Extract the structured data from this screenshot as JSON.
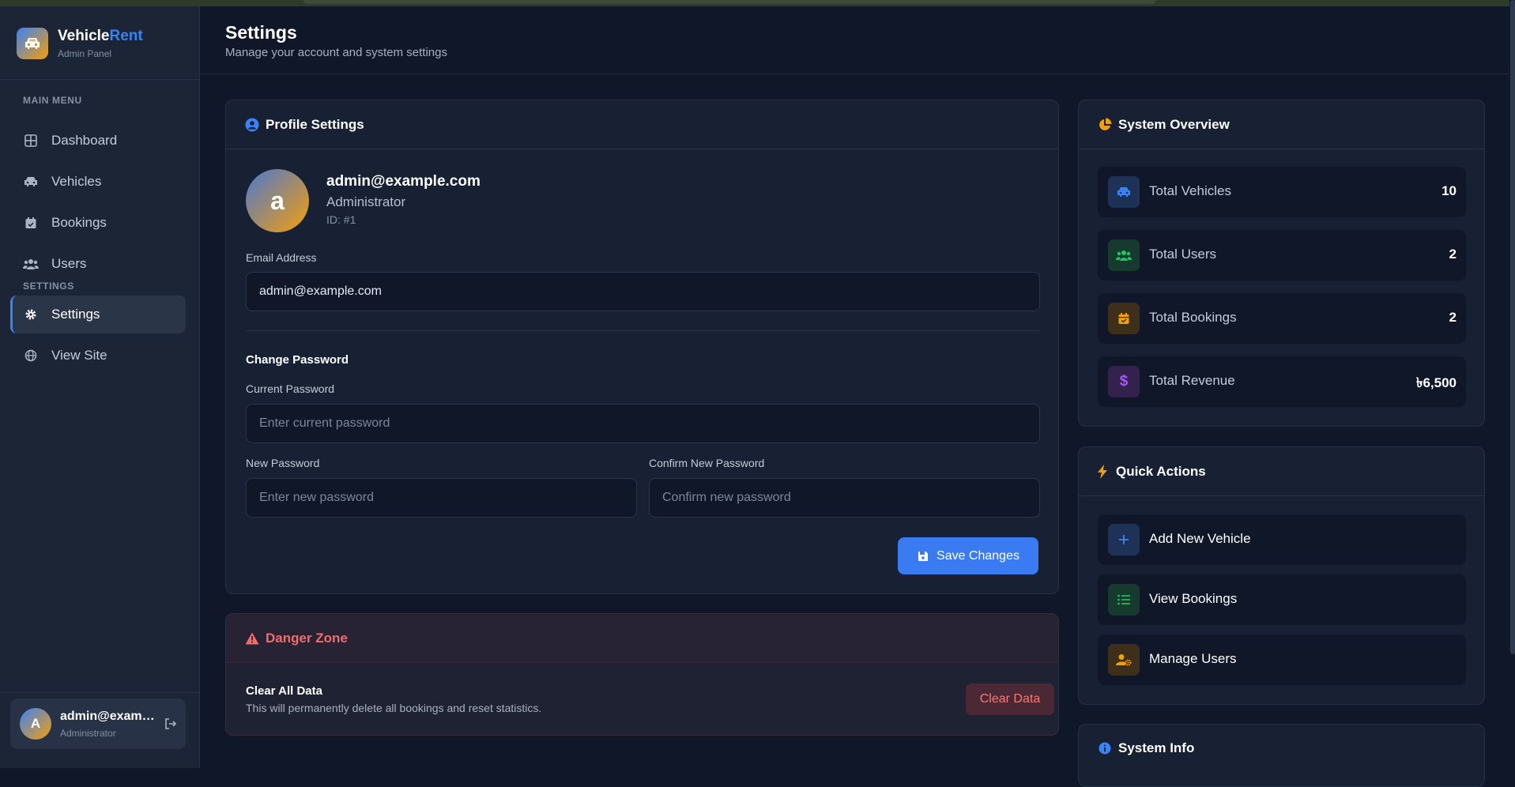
{
  "brand": {
    "name_main": "Vehicle",
    "name_accent": "Rent",
    "subtitle": "Admin Panel"
  },
  "sidebar": {
    "main_menu_label": "MAIN MENU",
    "settings_label": "SETTINGS",
    "items": [
      {
        "label": "Dashboard",
        "icon": "grid-icon"
      },
      {
        "label": "Vehicles",
        "icon": "car-icon"
      },
      {
        "label": "Bookings",
        "icon": "calendar-check-icon"
      },
      {
        "label": "Users",
        "icon": "users-icon"
      },
      {
        "label": "Settings",
        "icon": "gear-icon",
        "active": true
      },
      {
        "label": "View Site",
        "icon": "globe-icon"
      }
    ],
    "user": {
      "initial": "A",
      "name": "admin@example.com",
      "role": "Administrator"
    }
  },
  "header": {
    "title": "Settings",
    "subtitle": "Manage your account and system settings"
  },
  "profile": {
    "title": "Profile Settings",
    "avatar_initial": "a",
    "email": "admin@example.com",
    "role": "Administrator",
    "id_text": "ID: #1",
    "email_label": "Email Address",
    "email_value": "admin@example.com",
    "change_password_title": "Change Password",
    "current_password_label": "Current Password",
    "current_password_placeholder": "Enter current password",
    "new_password_label": "New Password",
    "new_password_placeholder": "Enter new password",
    "confirm_password_label": "Confirm New Password",
    "confirm_password_placeholder": "Confirm new password",
    "save_label": "Save Changes"
  },
  "danger_zone": {
    "title": "Danger Zone",
    "item_title": "Clear All Data",
    "item_desc": "This will permanently delete all bookings and reset statistics.",
    "button_label": "Clear Data"
  },
  "overview": {
    "title": "System Overview",
    "stats": [
      {
        "label": "Total Vehicles",
        "value": "10",
        "icon": "car-icon",
        "color": "#3b82f6"
      },
      {
        "label": "Total Users",
        "value": "2",
        "icon": "users-icon",
        "color": "#22c55e"
      },
      {
        "label": "Total Bookings",
        "value": "2",
        "icon": "calendar-icon",
        "color": "#f59e0b"
      },
      {
        "label": "Total Revenue",
        "value": "৳6,500",
        "icon": "dollar-icon",
        "color": "#a855f7"
      }
    ]
  },
  "quick_actions": {
    "title": "Quick Actions",
    "items": [
      {
        "label": "Add New Vehicle",
        "icon": "plus-icon",
        "color": "#3b82f6"
      },
      {
        "label": "View Bookings",
        "icon": "list-icon",
        "color": "#22c55e"
      },
      {
        "label": "Manage Users",
        "icon": "user-cog-icon",
        "color": "#f59e0b"
      }
    ]
  },
  "system_info": {
    "title": "System Info"
  }
}
